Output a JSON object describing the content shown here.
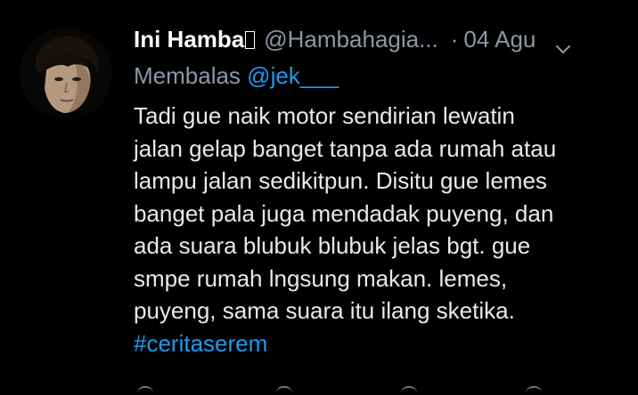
{
  "tweet": {
    "display_name": "Ini Hamba",
    "handle": "@Hambahagia...",
    "separator": "·",
    "date": "04 Agu",
    "reply_prefix": "Membalas",
    "reply_mention": "@jek___",
    "body_lines": [
      "Tadi gue naik motor sendirian lewatin",
      "jalan gelap banget tanpa ada rumah atau",
      "lampu jalan sedikitpun. Disitu gue lemes",
      "banget pala juga mendadak puyeng, dan",
      "ada suara blubuk blubuk jelas bgt. gue",
      "smpe rumah lngsung makan. lemes,",
      "puyeng, sama suara itu ilang sketika."
    ],
    "hashtag": "#ceritaserem"
  },
  "colors": {
    "background": "#000000",
    "text": "#e7e9ea",
    "secondary": "#8b98a5",
    "accent": "#1d9bf0"
  },
  "icons": {
    "avatar": "user-avatar",
    "more": "chevron-down-icon"
  }
}
